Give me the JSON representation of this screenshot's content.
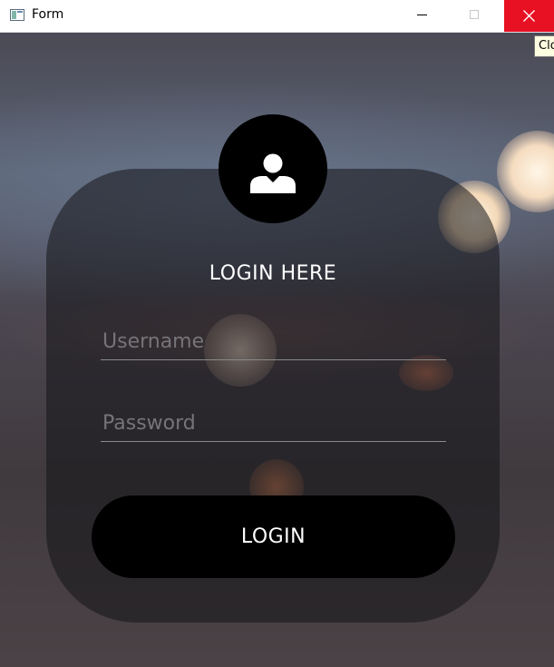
{
  "window": {
    "title": "Form",
    "close_tooltip": "Clo"
  },
  "titlebar_icons": [
    "app-icon",
    "minimize-icon",
    "maximize-icon",
    "close-icon"
  ],
  "colors": {
    "close_hover": "#e81123",
    "card_bg": "#141418",
    "button_bg": "#000000",
    "text": "#ffffff",
    "placeholder": "#767478"
  },
  "login": {
    "avatar_icon": "user-icon",
    "title": "LOGIN HERE",
    "username_placeholder": "Username",
    "username_value": "",
    "password_placeholder": "Password",
    "password_value": "",
    "button_label": "LOGIN"
  }
}
